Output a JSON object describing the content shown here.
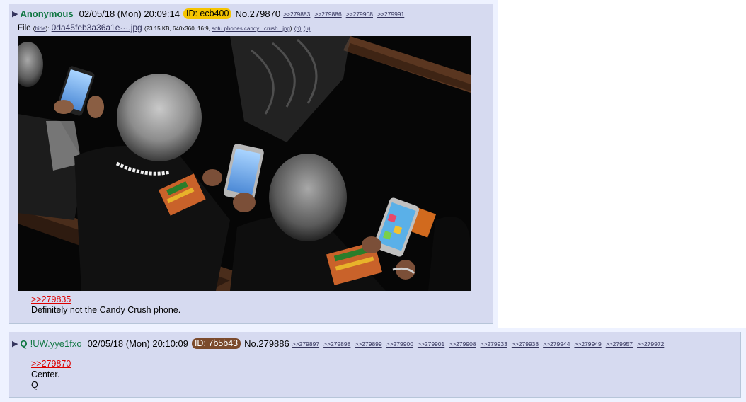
{
  "posts": [
    {
      "name": "Anonymous",
      "date": "02/05/18 (Mon) 20:09:14",
      "id": "ID: ecb400",
      "number": "No.279870",
      "backlinks": [
        ">>279883",
        ">>279886",
        ">>279908",
        ">>279991"
      ],
      "file": {
        "label": "File",
        "hide": "hide",
        "filename": "0da45feb3a36a1e···.jpg",
        "info_open": "(23.15 KB, 640x360, 16:9, ",
        "original_name": "sotu.phones.candy_.crush_.jpg",
        "info_close": ")",
        "h": "(h)",
        "u": "(u)"
      },
      "quote": ">>279835",
      "lines": [
        "Definitely not the Candy Crush phone."
      ]
    },
    {
      "name": "Q",
      "tripcode": "!UW.yye1fxo",
      "date": "02/05/18 (Mon) 20:10:09",
      "id": "ID: 7b5b43",
      "number": "No.279886",
      "backlinks": [
        ">>279897",
        ">>279898",
        ">>279899",
        ">>279900",
        ">>279901",
        ">>279908",
        ">>279933",
        ">>279938",
        ">>279944",
        ">>279949",
        ">>279957",
        ">>279972"
      ],
      "quote": ">>279870",
      "lines": [
        "Center.",
        "Q"
      ]
    }
  ],
  "colors": {
    "name_green": "#117743",
    "post_bg": "#d6daf0",
    "quote_red": "#dd0000",
    "link_blue": "#34345c",
    "id1_bg": "#f5c400",
    "id2_bg": "#7b4a2c"
  }
}
